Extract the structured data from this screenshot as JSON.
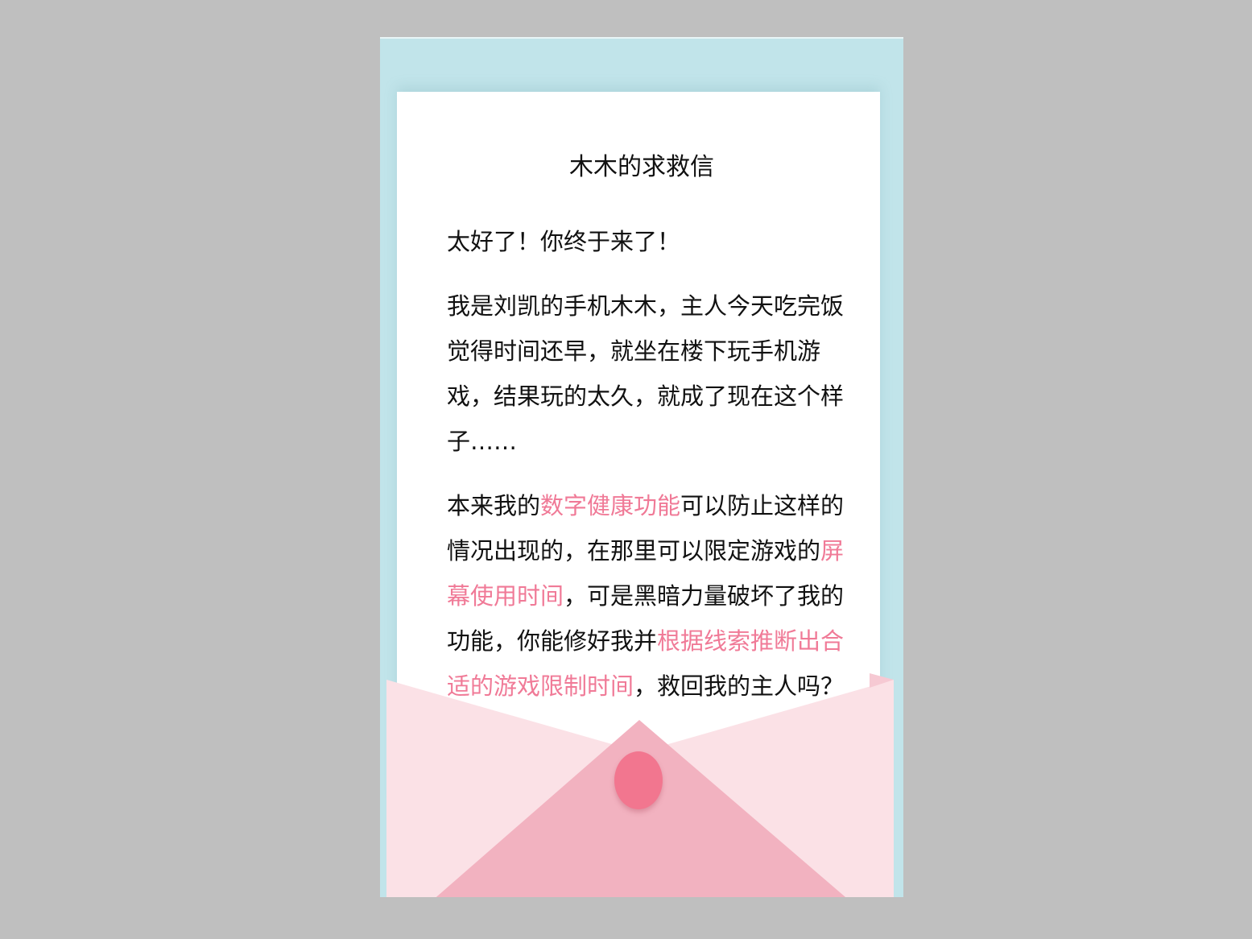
{
  "letter": {
    "title": "木木的求救信",
    "greeting": "太好了！你终于来了！",
    "para1": "我是刘凯的手机木木，主人今天吃完饭觉得时间还早，就坐在楼下玩手机游戏，结果玩的太久，就成了现在这个样子……",
    "para2": {
      "t1": "本来我的",
      "h1": "数字健康功能",
      "t2": "可以防止这样的情况出现的，在那里可以限定游戏的",
      "h2": "屏幕使用时间",
      "t3": "，可是黑暗力量破坏了我的功能，你能修好我并",
      "h3": "根据线索推断出合适的游戏限制时间",
      "t4": "，救回我的主人吗？"
    }
  },
  "colors": {
    "background": "#bfbfbf",
    "phone_bg": "#c1e4ea",
    "highlight": "#f07a97",
    "envelope_light": "#fbe1e6",
    "envelope_mid": "#f2b2c0",
    "seal": "#f2768f"
  }
}
